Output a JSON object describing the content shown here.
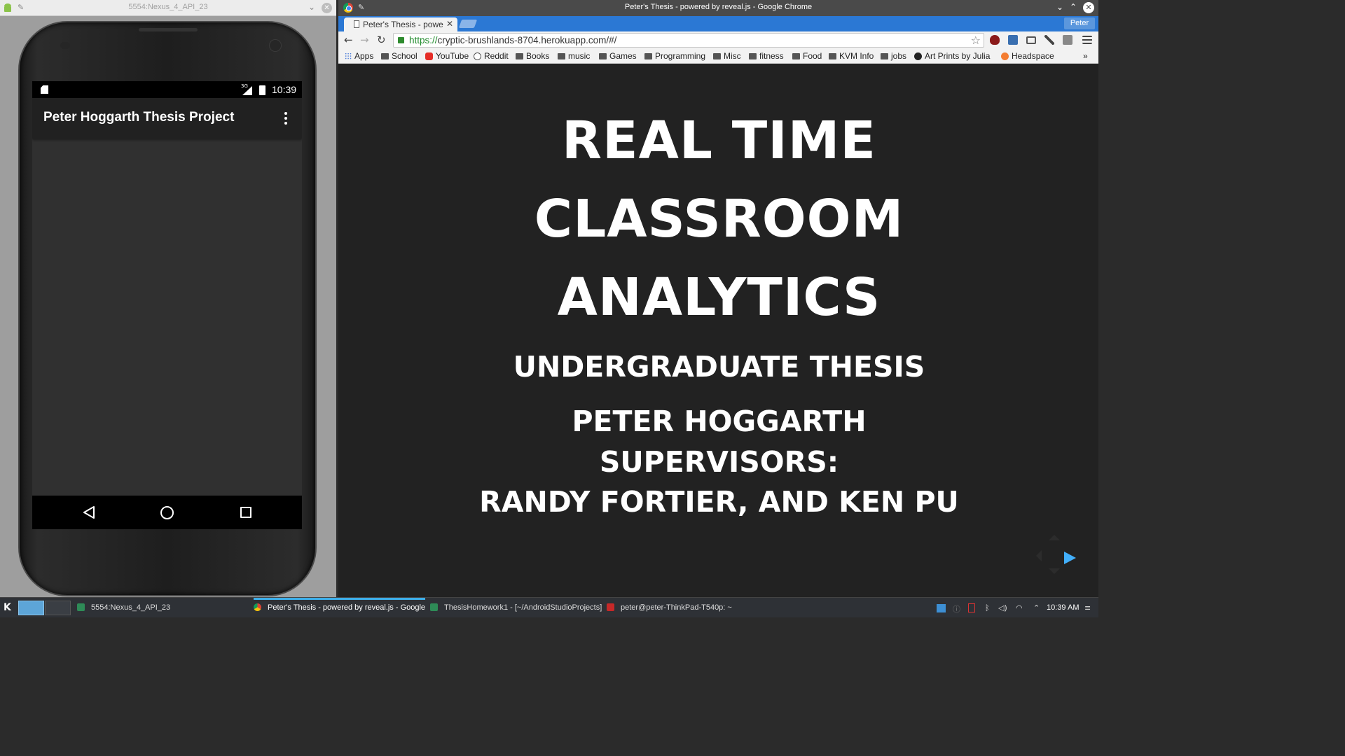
{
  "emulator": {
    "window_title": "5554:Nexus_4_API_23",
    "status_bar": {
      "network": "3G",
      "time": "10:39"
    },
    "app_bar": {
      "title": "Peter Hoggarth Thesis Project"
    }
  },
  "chrome": {
    "window_title": "Peter's Thesis - powered by reveal.js - Google Chrome",
    "profile": "Peter",
    "tab": {
      "label": "Peter's Thesis - powered by reveal.js"
    },
    "url": {
      "scheme": "https://",
      "rest": "cryptic-brushlands-8704.herokuapp.com/#/"
    },
    "bookmarks": [
      {
        "label": "Apps",
        "icon": "apps-grid-icon"
      },
      {
        "label": "School",
        "icon": "folder-icon"
      },
      {
        "label": "YouTube",
        "icon": "youtube-icon"
      },
      {
        "label": "Reddit",
        "icon": "reddit-icon"
      },
      {
        "label": "Books",
        "icon": "folder-icon"
      },
      {
        "label": "music",
        "icon": "folder-icon"
      },
      {
        "label": "Games",
        "icon": "folder-icon"
      },
      {
        "label": "Programming",
        "icon": "folder-icon"
      },
      {
        "label": "Misc",
        "icon": "folder-icon"
      },
      {
        "label": "fitness",
        "icon": "folder-icon"
      },
      {
        "label": "Food",
        "icon": "folder-icon"
      },
      {
        "label": "KVM Info",
        "icon": "folder-icon"
      },
      {
        "label": "jobs",
        "icon": "folder-icon"
      },
      {
        "label": "Art Prints by Julia",
        "icon": "site-icon"
      },
      {
        "label": "Headspace",
        "icon": "headspace-icon"
      }
    ],
    "bookmarks_overflow": "»"
  },
  "slide": {
    "title_line1": "REAL TIME",
    "title_line2": "CLASSROOM",
    "title_line3": "ANALYTICS",
    "subtitle": "UNDERGRADUATE THESIS",
    "author": "PETER HOGGARTH",
    "supervisors_label": "SUPERVISORS:",
    "supervisors": "RANDY FORTIER, AND KEN PU",
    "accent_color": "#42affa"
  },
  "taskbar": {
    "tasks": [
      {
        "label": "5554:Nexus_4_API_23"
      },
      {
        "label": "Peter's Thesis - powered by reveal.js - Google Chrome"
      },
      {
        "label": "ThesisHomework1 - [~/AndroidStudioProjects]"
      },
      {
        "label": "peter@peter-ThinkPad-T540p: ~"
      }
    ],
    "time": "10:39 AM"
  }
}
